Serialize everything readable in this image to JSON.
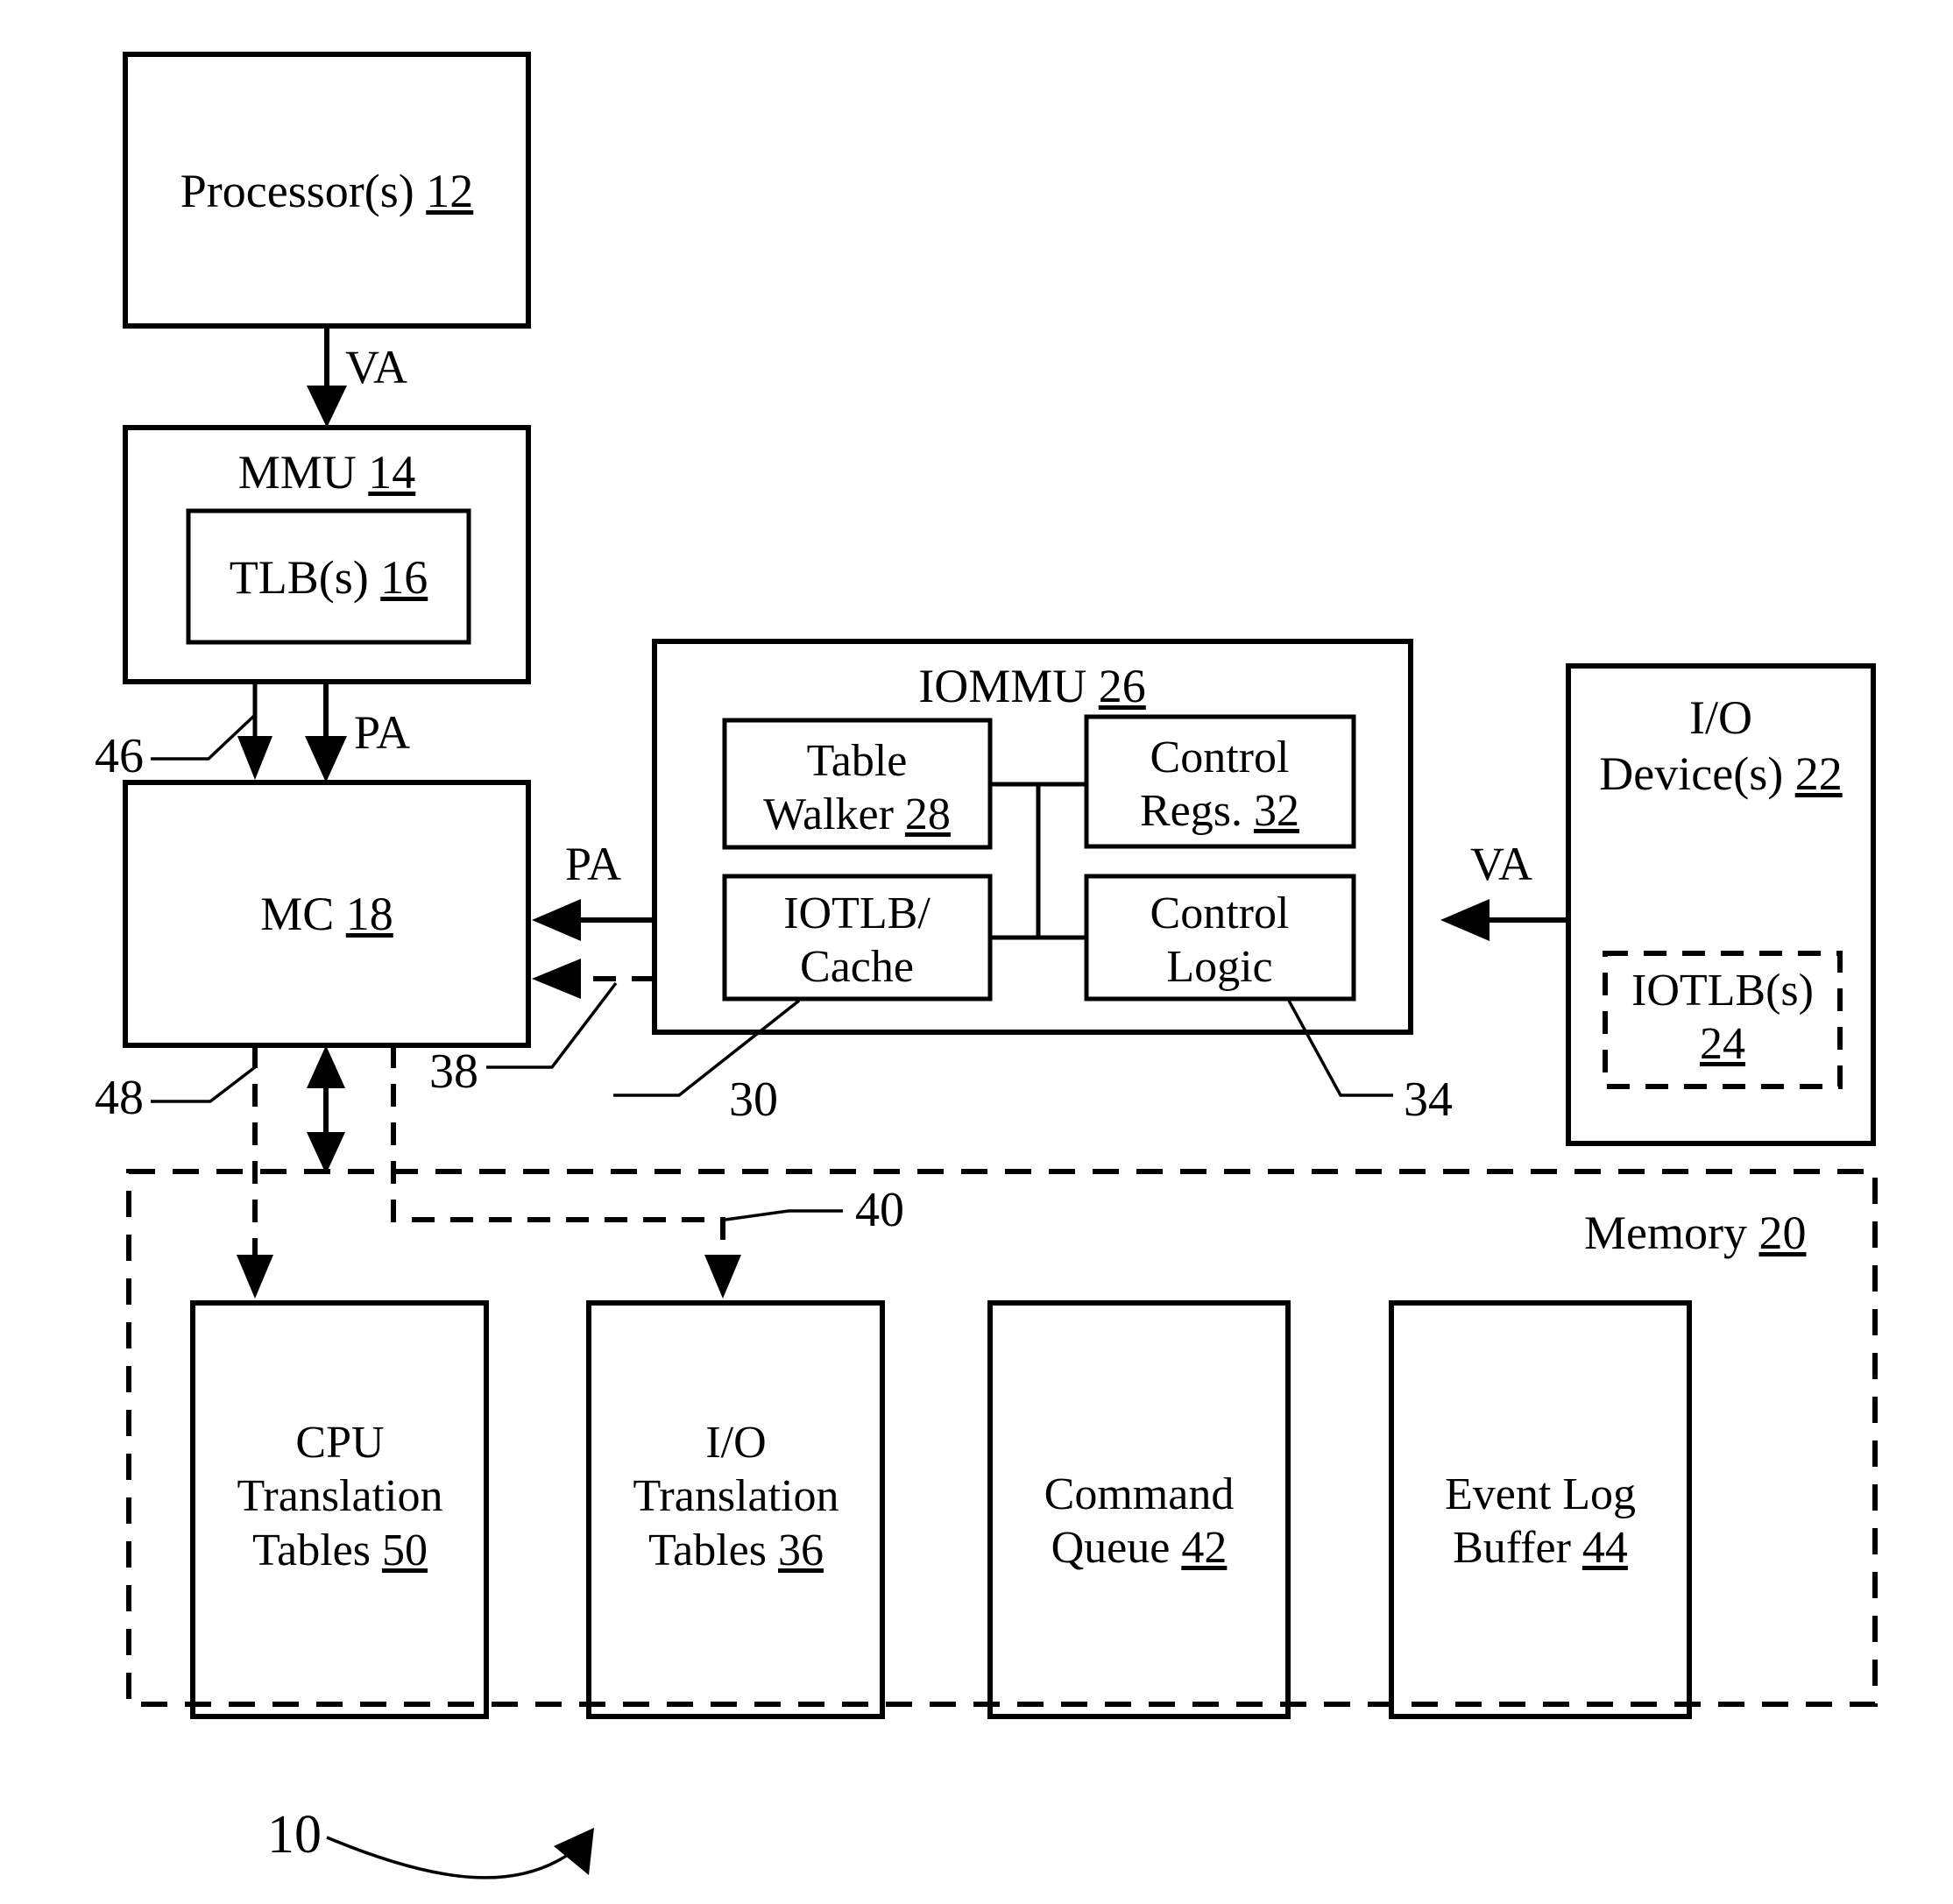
{
  "figure": {
    "number": "10",
    "title_blocks": {
      "processor": "Processor(s) 12",
      "mmu": "MMU 14",
      "tlb": "TLB(s) 16",
      "mc": "MC 18",
      "iommu": "IOMMU 26",
      "table_walker_line1": "Table",
      "table_walker_line2": "Walker 28",
      "control_regs_line1": "Control",
      "control_regs_line2": "Regs. 32",
      "iotlb_cache_line1": "IOTLB/",
      "iotlb_cache_line2": "Cache",
      "control_logic_line1": "Control",
      "control_logic_line2": "Logic",
      "io_device_line1": "I/O",
      "io_device_line2": "Device(s) 22",
      "iotlbs_line1": "IOTLB(s)",
      "iotlbs_line2": "24",
      "memory": "Memory 20",
      "cpu_tables_line1": "CPU",
      "cpu_tables_line2": "Translation",
      "cpu_tables_line3": "Tables 50",
      "io_tables_line1": "I/O",
      "io_tables_line2": "Translation",
      "io_tables_line3": "Tables 36",
      "command_queue_line1": "Command",
      "command_queue_line2": "Queue 42",
      "event_log_line1": "Event Log",
      "event_log_line2": "Buffer 44"
    },
    "signal_labels": {
      "va_processor_to_mmu": "VA",
      "pa_mmu_to_mc": "PA",
      "pa_iommu_to_mc": "PA",
      "va_iodevice_to_iommu": "VA"
    },
    "reference_numerals": {
      "ref_46": "46",
      "ref_48": "48",
      "ref_38": "38",
      "ref_30": "30",
      "ref_34": "34",
      "ref_40": "40",
      "ref_10": "10"
    },
    "underlined_numerals": {
      "n12": "12",
      "n14": "14",
      "n16": "16",
      "n18": "18",
      "n20": "20",
      "n22": "22",
      "n24": "24",
      "n26": "26",
      "n28": "28",
      "n32": "32",
      "n36": "36",
      "n42": "42",
      "n44": "44",
      "n50": "50"
    },
    "colors": {
      "stroke": "#000000",
      "background": "#ffffff"
    }
  }
}
